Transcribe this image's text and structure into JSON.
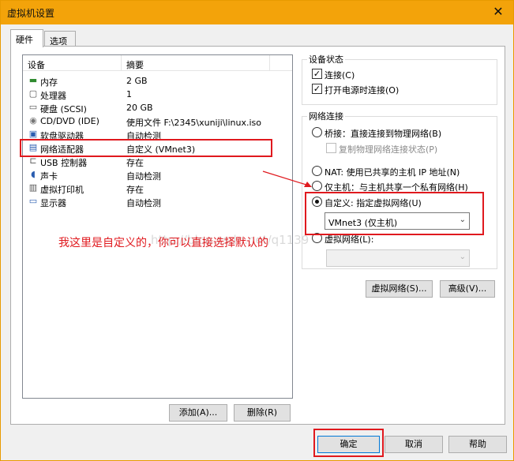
{
  "window": {
    "title": "虚拟机设置",
    "close_glyph": "✕"
  },
  "tabs": [
    {
      "label": "硬件",
      "active": true
    },
    {
      "label": "选项",
      "active": false
    }
  ],
  "device_list": {
    "col_device": "设备",
    "col_summary": "摘要",
    "items": [
      {
        "icon": "memory-icon",
        "glyph": "▬",
        "name": "内存",
        "summary": "2 GB"
      },
      {
        "icon": "cpu-icon",
        "glyph": "▢",
        "name": "处理器",
        "summary": "1"
      },
      {
        "icon": "harddisk-icon",
        "glyph": "▭",
        "name": "硬盘 (SCSI)",
        "summary": "20 GB"
      },
      {
        "icon": "cdrom-icon",
        "glyph": "◉",
        "name": "CD/DVD (IDE)",
        "summary": "使用文件 F:\\2345\\xuniji\\linux.iso"
      },
      {
        "icon": "floppy-icon",
        "glyph": "▣",
        "name": "软盘驱动器",
        "summary": "自动检测"
      },
      {
        "icon": "network-adapter-icon",
        "glyph": "▤",
        "name": "网络适配器",
        "summary": "自定义 (VMnet3)"
      },
      {
        "icon": "usb-icon",
        "glyph": "⊏",
        "name": "USB 控制器",
        "summary": "存在"
      },
      {
        "icon": "sound-icon",
        "glyph": "◖",
        "name": "声卡",
        "summary": "自动检测"
      },
      {
        "icon": "printer-icon",
        "glyph": "▥",
        "name": "虚拟打印机",
        "summary": "存在"
      },
      {
        "icon": "display-icon",
        "glyph": "▭",
        "name": "显示器",
        "summary": "自动检测"
      }
    ],
    "selected_index": 5
  },
  "buttons": {
    "add": "添加(A)...",
    "remove": "删除(R)",
    "virtual_network": "虚拟网络(S)...",
    "advanced": "高级(V)...",
    "ok": "确定",
    "cancel": "取消",
    "help": "帮助"
  },
  "device_status": {
    "legend": "设备状态",
    "connected": {
      "label": "连接(C)",
      "checked": true
    },
    "connect_on_power": {
      "label": "打开电源时连接(O)",
      "checked": true
    }
  },
  "network_connection": {
    "legend": "网络连接",
    "bridged": {
      "label": "桥接：直接连接到物理网络(B)",
      "selected": false
    },
    "replicate": {
      "label": "复制物理网络连接状态(P)",
      "checked": false
    },
    "nat": {
      "label": "NAT: 使用已共享的主机 IP 地址(N)",
      "selected": false
    },
    "host_only": {
      "label": "仅主机：与主机共享一个私有网络(H)",
      "selected": false
    },
    "custom": {
      "label": "自定义: 指定虚拟网络(U)",
      "selected": true
    },
    "custom_value": "VMnet3 (仅主机)",
    "lan_segment": {
      "label": "虚拟网络(L):",
      "selected": false
    },
    "lan_value": ""
  },
  "annotation": {
    "text": "我这里是自定义的，你可以直接选择默认的",
    "watermark": "http://blog.csdn.net/q1139"
  },
  "colors": {
    "titlebar": "#f3a30a",
    "annotation_red": "#e0191e"
  }
}
